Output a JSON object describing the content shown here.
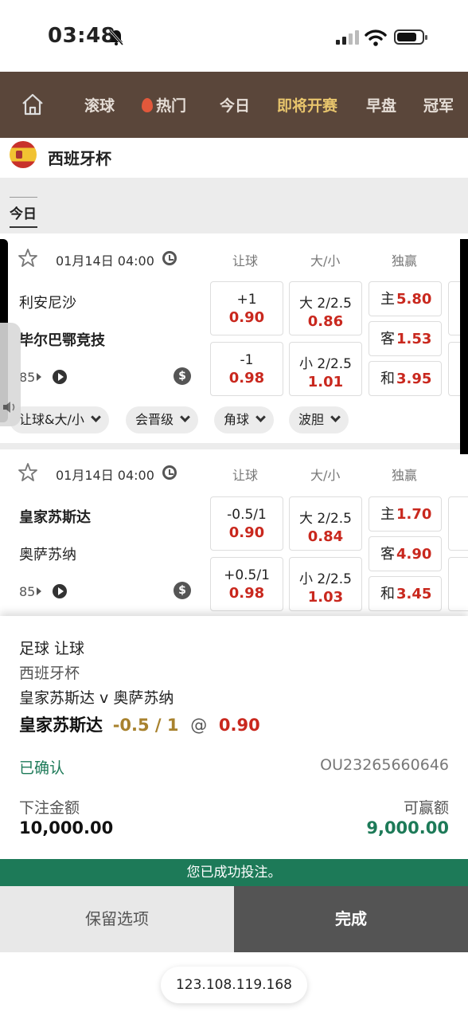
{
  "status": {
    "time": "03:48"
  },
  "nav": {
    "tabs": [
      "滚球",
      "热门",
      "今日",
      "即将开赛",
      "早盘",
      "冠军"
    ],
    "active": "即将开赛"
  },
  "league": {
    "name": "西班牙杯",
    "filter_today": "今日"
  },
  "columns": {
    "handicap": "让球",
    "over_under": "大/小",
    "moneyline": "独赢"
  },
  "matches": [
    {
      "datetime": "01月14日 04:00",
      "home": "利安尼沙",
      "away": "毕尔巴鄂竞技",
      "count": "85",
      "hdp": [
        {
          "line": "+1",
          "odds": "0.90"
        },
        {
          "line": "-1",
          "odds": "0.98"
        }
      ],
      "ou": [
        {
          "line": "大 2/2.5",
          "odds": "0.86"
        },
        {
          "line": "小 2/2.5",
          "odds": "1.01"
        }
      ],
      "ml": [
        {
          "label": "主",
          "odds": "5.80"
        },
        {
          "label": "客",
          "odds": "1.53"
        },
        {
          "label": "和",
          "odds": "3.95"
        }
      ],
      "chips": [
        "让球&大/小",
        "会晋级",
        "角球",
        "波胆"
      ]
    },
    {
      "datetime": "01月14日 04:00",
      "home": "皇家苏斯达",
      "away": "奥萨苏纳",
      "count": "85",
      "hdp": [
        {
          "line": "-0.5/1",
          "odds": "0.90"
        },
        {
          "line": "+0.5/1",
          "odds": "0.98"
        }
      ],
      "ou": [
        {
          "line": "大 2/2.5",
          "odds": "0.84"
        },
        {
          "line": "小 2/2.5",
          "odds": "1.03"
        }
      ],
      "ml": [
        {
          "label": "主",
          "odds": "1.70"
        },
        {
          "label": "客",
          "odds": "4.90"
        },
        {
          "label": "和",
          "odds": "3.45"
        }
      ]
    }
  ],
  "slip": {
    "market": "足球 让球",
    "league": "西班牙杯",
    "fixture": "皇家苏斯达 v 奥萨苏纳",
    "selection_team": "皇家苏斯达",
    "selection_handicap": "-0.5 / 1",
    "at": "@",
    "selection_odds": "0.90",
    "status": "已确认",
    "ref": "OU23265660646",
    "stake_label": "下注金额",
    "stake": "10,000.00",
    "win_label": "可赢额",
    "win": "9,000.00"
  },
  "success_msg": "您已成功投注。",
  "buttons": {
    "keep": "保留选项",
    "done": "完成"
  },
  "url": "123.108.119.168",
  "colors": {
    "nav_bg": "#5a463a",
    "nav_active": "#e7c46c",
    "odds_red": "#c9281e",
    "success_green": "#1d7a58"
  }
}
